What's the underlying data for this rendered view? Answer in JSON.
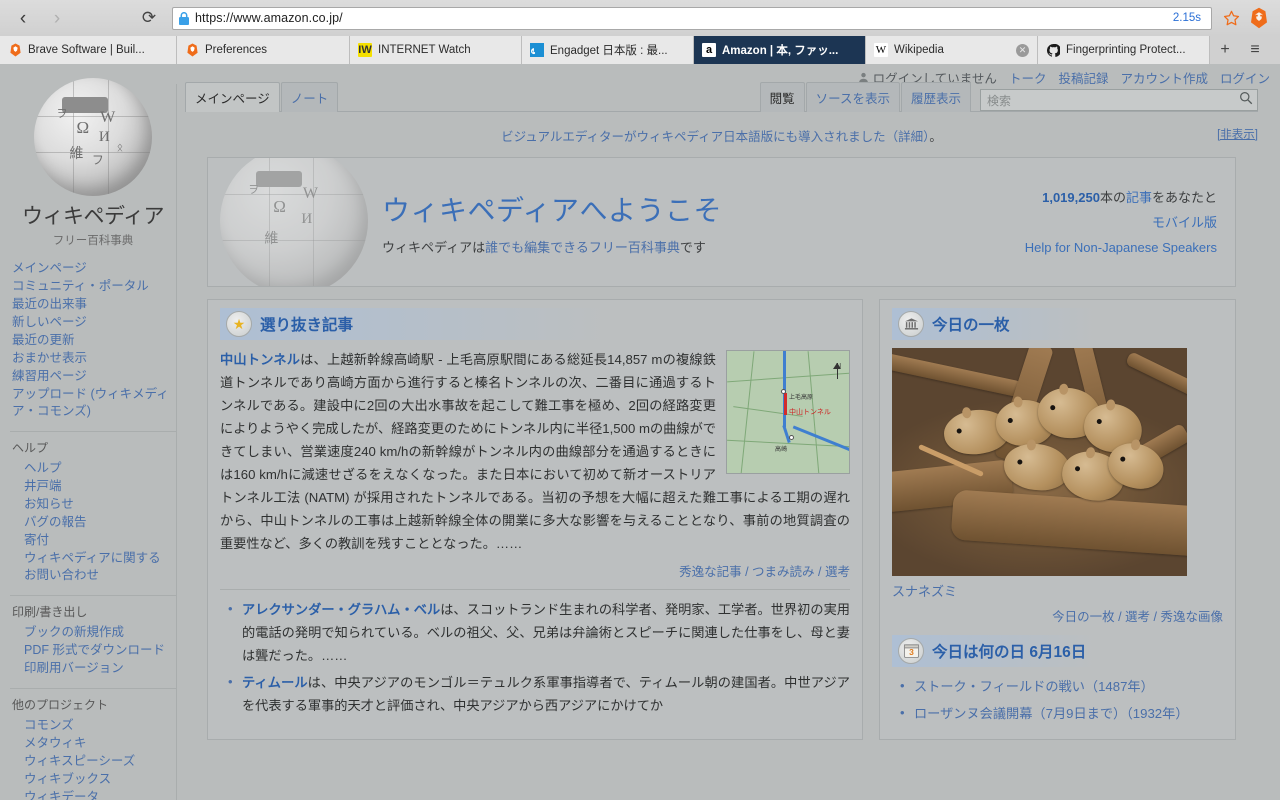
{
  "browser": {
    "back_label": "‹",
    "forward_label": "›",
    "reload_label": "⟳",
    "url": "https://www.amazon.co.jp/",
    "load_time": "2.15s",
    "lock_icon": "lock-icon",
    "star_icon": "bookmark-star-icon",
    "brave_icon": "brave-lion-icon",
    "new_tab_label": "+",
    "menu_label": "≡",
    "tabs": [
      {
        "label": "Brave Software | Buil...",
        "favicon": "brave-lion-icon",
        "glyph": "◆",
        "active": false,
        "close": false
      },
      {
        "label": "Preferences",
        "favicon": "brave-lion-icon",
        "glyph": "◆",
        "active": false,
        "close": false
      },
      {
        "label": "INTERNET Watch",
        "favicon": "internet-watch-icon",
        "glyph": "IW",
        "active": false,
        "close": false
      },
      {
        "label": "Engadget 日本版 : 最...",
        "favicon": "engadget-icon",
        "glyph": "◐",
        "active": false,
        "close": false
      },
      {
        "label": "Amazon | 本, ファッ...",
        "favicon": "amazon-icon",
        "glyph": "a",
        "active": true,
        "close": false
      },
      {
        "label": "Wikipedia",
        "favicon": "wikipedia-icon",
        "glyph": "W",
        "active": false,
        "close": true
      },
      {
        "label": "Fingerprinting Protect...",
        "favicon": "github-icon",
        "glyph": "●",
        "active": false,
        "close": false
      }
    ]
  },
  "personal_bar": {
    "not_logged_in": "ログインしていません",
    "user_icon": "user-icon",
    "links": [
      "トーク",
      "投稿記録",
      "アカウント作成",
      "ログイン"
    ]
  },
  "sidebar": {
    "wordmark": "ウィキペディア",
    "tagline": "フリー百科事典",
    "logo_icon": "wikipedia-globe-icon",
    "globe_glyphs": [
      "Ω",
      "W",
      "И",
      "維",
      "ヲ",
      "ᛟ",
      "フ"
    ],
    "nav": [
      {
        "heading": "",
        "indent": false,
        "bordered": false,
        "items": [
          "メインページ",
          "コミュニティ・ポータル",
          "最近の出来事",
          "新しいページ",
          "最近の更新",
          "おまかせ表示",
          "練習用ページ",
          "アップロード (ウィキメディア・コモンズ)"
        ]
      },
      {
        "heading": "ヘルプ",
        "indent": true,
        "bordered": true,
        "items": [
          "ヘルプ",
          "井戸端",
          "お知らせ",
          "バグの報告",
          "寄付",
          "ウィキペディアに関するお問い合わせ"
        ]
      },
      {
        "heading": "印刷/書き出し",
        "indent": true,
        "bordered": true,
        "items": [
          "ブックの新規作成",
          "PDF 形式でダウンロード",
          "印刷用バージョン"
        ]
      },
      {
        "heading": "他のプロジェクト",
        "indent": true,
        "bordered": true,
        "items": [
          "コモンズ",
          "メタウィキ",
          "ウィキスピーシーズ",
          "ウィキブックス",
          "ウィキデータ"
        ]
      }
    ]
  },
  "content_tabs": {
    "left": [
      {
        "label": "メインページ",
        "selected": true
      },
      {
        "label": "ノート",
        "selected": false
      }
    ],
    "right": [
      {
        "label": "閲覧",
        "selected": true
      },
      {
        "label": "ソースを表示",
        "selected": false
      },
      {
        "label": "履歴表示",
        "selected": false
      }
    ]
  },
  "search": {
    "placeholder": "検索",
    "value": "",
    "icon": "search-icon"
  },
  "sitenotice": {
    "text_a": "ビジュアルエディターがウィキペディア日本語版にも導入されました",
    "detail": "（詳細）",
    "period": "。",
    "dismiss": "[非表示]"
  },
  "welcome": {
    "title": "ウィキペディアへようこそ",
    "sub_prefix": "ウィキペディアは",
    "sub_link1": "誰でも編集できる",
    "sub_link2": "フリー百科事典",
    "sub_suffix": "です",
    "article_count": "1,019,250",
    "article_count_suffix_a": "本の",
    "article_count_link": "記事",
    "article_count_suffix_b": "をあなたと",
    "mobile_link": "モバイル版",
    "help_link": "Help for Non-Japanese Speakers"
  },
  "featured": {
    "icon": "star-icon",
    "icon_glyph": "★",
    "title": "選り抜き記事",
    "lead_bold": "中山トンネル",
    "body": "は、上越新幹線高崎駅 - 上毛高原駅間にある総延長14,857 mの複線鉄道トンネルであり高崎方面から進行すると榛名トンネルの次、二番目に通過するトンネルである。建設中に2回の大出水事故を起こして難工事を極め、2回の経路変更によりようやく完成したが、経路変更のためにトンネル内に半径1,500 mの曲線ができてしまい、営業速度240 km/hの新幹線がトンネル内の曲線部分を通過するときには160 km/hに減速せざるをえなくなった。また日本において初めて新オーストリアトンネル工法 (NATM) が採用されたトンネルである。当初の予想を大幅に超えた難工事による工期の遅れから、中山トンネルの工事は上越新幹線全体の開業に多大な影響を与えることとなり、事前の地質調査の重要性など、多くの教訓を残すこととなった。……",
    "map_labels": {
      "north": "N",
      "station": "上毛高原",
      "tunnel": "中山トンネル",
      "city": "高崎"
    },
    "links": [
      "秀逸な記事",
      "つまみ読み",
      "選考"
    ],
    "bullets": [
      {
        "bold": "アレクサンダー・グラハム・ベル",
        "text": "は、スコットランド生まれの科学者、発明家、工学者。世界初の実用的電話の発明で知られている。ベルの祖父、父、兄弟は弁論術とスピーチに関連した仕事をし、母と妻は聾だった。……"
      },
      {
        "bold": "ティムール",
        "text": "は、中央アジアのモンゴル＝テュルク系軍事指導者で、ティムール朝の建国者。中世アジアを代表する軍事的天才と評価され、中央アジアから西アジアにかけてか"
      }
    ]
  },
  "potd": {
    "icon": "museum-icon",
    "icon_glyph": "🏛",
    "title": "今日の一枚",
    "image_alt": "スナネズミの群れの写真",
    "caption": "スナネズミ",
    "links": [
      "今日の一枚",
      "選考",
      "秀逸な画像"
    ]
  },
  "onthisday": {
    "icon": "calendar-icon",
    "icon_glyph": "3",
    "title": "今日は何の日",
    "date": "6月16日",
    "items": [
      "ストーク・フィールドの戦い（1487年）",
      "ローザンヌ会議開幕（7月9日まで）（1932年）"
    ]
  },
  "colors": {
    "link": "#4a6fa9",
    "heading": "#2b5fa8",
    "page_bg": "#b9bcbc",
    "box_bg": "#bcbfc0",
    "active_tab_bg": "#1c3553",
    "brave_orange": "#e2590c"
  }
}
